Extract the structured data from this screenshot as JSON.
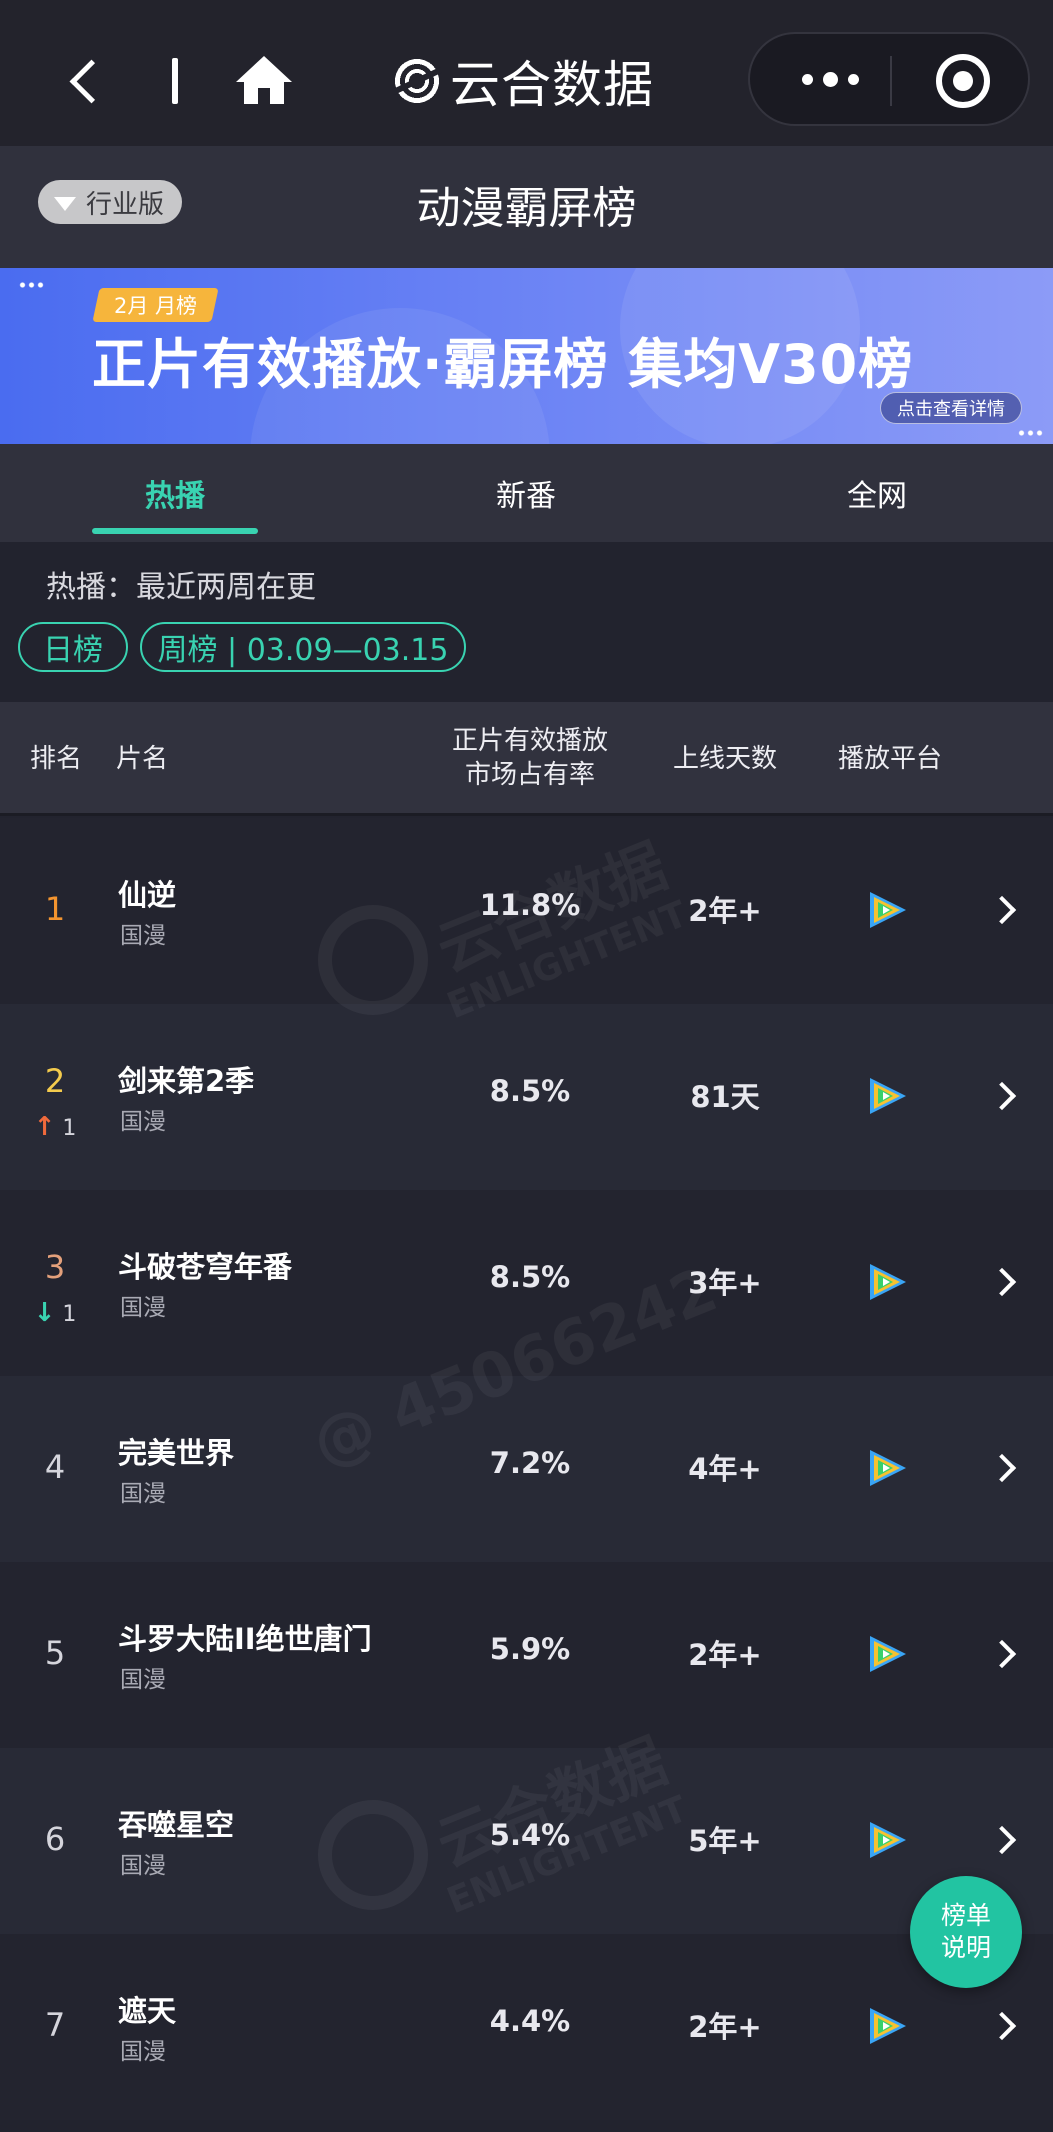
{
  "brand": {
    "name": "云合数据"
  },
  "header": {
    "badge": "行业版",
    "title": "动漫霸屏榜"
  },
  "banner": {
    "tag": "2月 月榜",
    "title": "正片有效播放·霸屏榜 集均V30榜",
    "button": "点击查看详情"
  },
  "tabs": [
    {
      "label": "热播",
      "active": true
    },
    {
      "label": "新番",
      "active": false
    },
    {
      "label": "全网",
      "active": false
    }
  ],
  "filter": {
    "hint": "热播：最近两周在更",
    "daily": "日榜",
    "weekly": "周榜 | 03.09—03.15"
  },
  "table": {
    "headers": {
      "rank": "排名",
      "title": "片名",
      "share_line1": "正片有效播放",
      "share_line2": "市场占有率",
      "days": "上线天数",
      "platform": "播放平台"
    },
    "rows": [
      {
        "rank": "1",
        "change": "",
        "name": "仙逆",
        "genre": "国漫",
        "share": "11.8%",
        "days": "2年+",
        "platform_icon": "tencent-video-icon"
      },
      {
        "rank": "2",
        "change": "1",
        "change_dir": "up",
        "name": "剑来第2季",
        "genre": "国漫",
        "share": "8.5%",
        "days": "81天",
        "platform_icon": "tencent-video-icon"
      },
      {
        "rank": "3",
        "change": "1",
        "change_dir": "down",
        "name": "斗破苍穹年番",
        "genre": "国漫",
        "share": "8.5%",
        "days": "3年+",
        "platform_icon": "tencent-video-icon"
      },
      {
        "rank": "4",
        "change": "",
        "name": "完美世界",
        "genre": "国漫",
        "share": "7.2%",
        "days": "4年+",
        "platform_icon": "tencent-video-icon"
      },
      {
        "rank": "5",
        "change": "",
        "name": "斗罗大陆II绝世唐门",
        "genre": "国漫",
        "share": "5.9%",
        "days": "2年+",
        "platform_icon": "tencent-video-icon"
      },
      {
        "rank": "6",
        "change": "",
        "name": "吞噬星空",
        "genre": "国漫",
        "share": "5.4%",
        "days": "5年+",
        "platform_icon": "tencent-video-icon"
      },
      {
        "rank": "7",
        "change": "",
        "name": "遮天",
        "genre": "国漫",
        "share": "4.4%",
        "days": "2年+",
        "platform_icon": "tencent-video-icon"
      }
    ]
  },
  "watermark": {
    "brand": "云合数据",
    "brand_en": "ENLIGHTENT",
    "user": "@ 45066242"
  },
  "fab": {
    "line1": "榜单",
    "line2": "说明"
  },
  "colors": {
    "accent": "#39d3b1",
    "rank1": "#f3942f",
    "rank2": "#f4cb4d",
    "rank3": "#e3a07b",
    "up": "#f06a3c",
    "down": "#39d3b1"
  }
}
